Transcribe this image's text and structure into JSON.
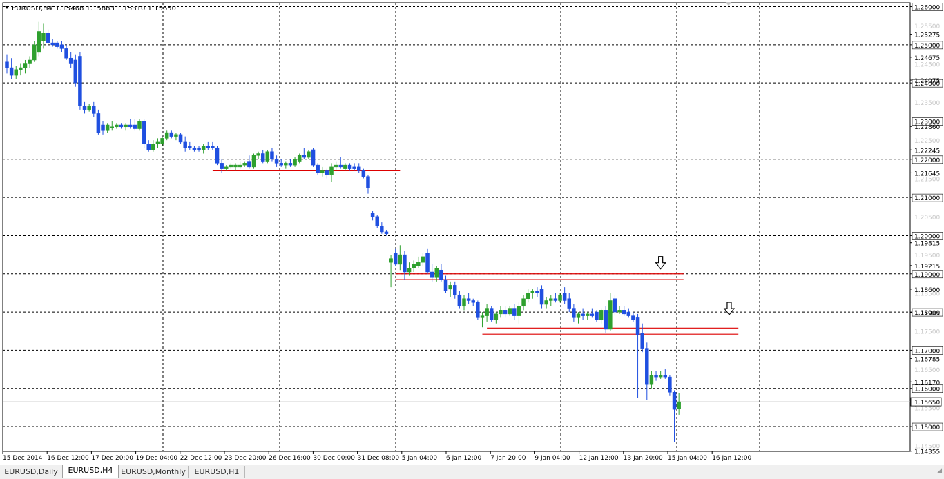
{
  "chart_header": {
    "symbol_label": "EURUSD,H4",
    "ohlc_text": "1.15468 1.15883 1.15310 1.15650"
  },
  "price_axis": {
    "main_labels": [
      "1.26000",
      "1.25000",
      "1.24000",
      "1.23000",
      "1.22000",
      "1.21000",
      "1.20000",
      "1.19000",
      "1.18000",
      "1.17000",
      "1.16000",
      "1.15000"
    ],
    "faint_labels": [
      "1.25500",
      "1.24500",
      "1.23500",
      "1.22500",
      "1.21500",
      "1.20500",
      "1.19500",
      "1.18500",
      "1.17500",
      "1.16500",
      "1.15500",
      "1.14500"
    ],
    "extra_labels": [
      "1.25275",
      "1.24675",
      "1.24075",
      "1.22860",
      "1.22245",
      "1.21645",
      "1.19815",
      "1.19215",
      "1.18600",
      "1.17985",
      "1.16785",
      "1.16170",
      "1.14355"
    ],
    "current_price": "1.15650"
  },
  "time_axis": {
    "labels": [
      "15 Dec 2014",
      "16 Dec 12:00",
      "17 Dec 20:00",
      "19 Dec 04:00",
      "22 Dec 12:00",
      "23 Dec 20:00",
      "26 Dec 16:00",
      "30 Dec 00:00",
      "31 Dec 08:00",
      "5 Jan 04:00",
      "6 Jan 12:00",
      "7 Jan 20:00",
      "9 Jan 04:00",
      "12 Jan 12:00",
      "13 Jan 20:00",
      "15 Jan 04:00",
      "16 Jan 12:00"
    ]
  },
  "tabs": [
    {
      "label": "EURUSD,Daily",
      "active": false
    },
    {
      "label": "EURUSD,H4",
      "active": true
    },
    {
      "label": "EURUSD,Monthly",
      "active": false
    },
    {
      "label": "EURUSD,H1",
      "active": false
    }
  ],
  "colors": {
    "bull": "#2ea02e",
    "bear": "#1f4fe0",
    "level_line": "#dd0000",
    "grid": "#000000"
  },
  "chart_data": {
    "type": "candlestick",
    "symbol": "EURUSD",
    "timeframe": "H4",
    "ylim": [
      1.1435,
      1.261
    ],
    "candles": [
      {
        "o": 1.2455,
        "h": 1.2475,
        "l": 1.2425,
        "c": 1.244
      },
      {
        "o": 1.244,
        "h": 1.2465,
        "l": 1.241,
        "c": 1.242
      },
      {
        "o": 1.242,
        "h": 1.2445,
        "l": 1.241,
        "c": 1.2435
      },
      {
        "o": 1.2435,
        "h": 1.245,
        "l": 1.242,
        "c": 1.244
      },
      {
        "o": 1.244,
        "h": 1.246,
        "l": 1.2425,
        "c": 1.245
      },
      {
        "o": 1.245,
        "h": 1.247,
        "l": 1.244,
        "c": 1.246
      },
      {
        "o": 1.246,
        "h": 1.251,
        "l": 1.2455,
        "c": 1.25
      },
      {
        "o": 1.248,
        "h": 1.256,
        "l": 1.247,
        "c": 1.2535
      },
      {
        "o": 1.251,
        "h": 1.2555,
        "l": 1.249,
        "c": 1.253
      },
      {
        "o": 1.253,
        "h": 1.254,
        "l": 1.25,
        "c": 1.2505
      },
      {
        "o": 1.2505,
        "h": 1.2515,
        "l": 1.2495,
        "c": 1.25
      },
      {
        "o": 1.2505,
        "h": 1.251,
        "l": 1.249,
        "c": 1.2495
      },
      {
        "o": 1.25,
        "h": 1.251,
        "l": 1.248,
        "c": 1.249
      },
      {
        "o": 1.249,
        "h": 1.25,
        "l": 1.246,
        "c": 1.2465
      },
      {
        "o": 1.2465,
        "h": 1.248,
        "l": 1.244,
        "c": 1.245
      },
      {
        "o": 1.246,
        "h": 1.2475,
        "l": 1.239,
        "c": 1.24
      },
      {
        "o": 1.247,
        "h": 1.248,
        "l": 1.233,
        "c": 1.234
      },
      {
        "o": 1.234,
        "h": 1.235,
        "l": 1.232,
        "c": 1.233
      },
      {
        "o": 1.233,
        "h": 1.2345,
        "l": 1.2325,
        "c": 1.234
      },
      {
        "o": 1.234,
        "h": 1.235,
        "l": 1.231,
        "c": 1.232
      },
      {
        "o": 1.232,
        "h": 1.233,
        "l": 1.2265,
        "c": 1.227
      },
      {
        "o": 1.229,
        "h": 1.23,
        "l": 1.2265,
        "c": 1.2275
      },
      {
        "o": 1.2275,
        "h": 1.2295,
        "l": 1.227,
        "c": 1.229
      },
      {
        "o": 1.2285,
        "h": 1.23,
        "l": 1.2275,
        "c": 1.2285
      },
      {
        "o": 1.2285,
        "h": 1.2295,
        "l": 1.228,
        "c": 1.229
      },
      {
        "o": 1.229,
        "h": 1.2295,
        "l": 1.228,
        "c": 1.2285
      },
      {
        "o": 1.2285,
        "h": 1.2295,
        "l": 1.2275,
        "c": 1.229
      },
      {
        "o": 1.229,
        "h": 1.2305,
        "l": 1.228,
        "c": 1.2285
      },
      {
        "o": 1.229,
        "h": 1.2305,
        "l": 1.2275,
        "c": 1.228
      },
      {
        "o": 1.228,
        "h": 1.2305,
        "l": 1.2275,
        "c": 1.23
      },
      {
        "o": 1.23,
        "h": 1.2305,
        "l": 1.223,
        "c": 1.224
      },
      {
        "o": 1.224,
        "h": 1.225,
        "l": 1.222,
        "c": 1.2225
      },
      {
        "o": 1.2225,
        "h": 1.225,
        "l": 1.222,
        "c": 1.224
      },
      {
        "o": 1.224,
        "h": 1.2255,
        "l": 1.223,
        "c": 1.2245
      },
      {
        "o": 1.224,
        "h": 1.226,
        "l": 1.2235,
        "c": 1.2255
      },
      {
        "o": 1.2255,
        "h": 1.2275,
        "l": 1.225,
        "c": 1.227
      },
      {
        "o": 1.227,
        "h": 1.2275,
        "l": 1.2255,
        "c": 1.226
      },
      {
        "o": 1.226,
        "h": 1.227,
        "l": 1.225,
        "c": 1.2265
      },
      {
        "o": 1.2265,
        "h": 1.227,
        "l": 1.224,
        "c": 1.2245
      },
      {
        "o": 1.2245,
        "h": 1.226,
        "l": 1.222,
        "c": 1.223
      },
      {
        "o": 1.2235,
        "h": 1.2245,
        "l": 1.2225,
        "c": 1.223
      },
      {
        "o": 1.223,
        "h": 1.2235,
        "l": 1.222,
        "c": 1.2225
      },
      {
        "o": 1.223,
        "h": 1.2235,
        "l": 1.222,
        "c": 1.2225
      },
      {
        "o": 1.2225,
        "h": 1.224,
        "l": 1.2215,
        "c": 1.2235
      },
      {
        "o": 1.2235,
        "h": 1.2245,
        "l": 1.2225,
        "c": 1.223
      },
      {
        "o": 1.2235,
        "h": 1.2245,
        "l": 1.2225,
        "c": 1.223
      },
      {
        "o": 1.223,
        "h": 1.2235,
        "l": 1.2185,
        "c": 1.219
      },
      {
        "o": 1.219,
        "h": 1.22,
        "l": 1.2165,
        "c": 1.2175
      },
      {
        "o": 1.2175,
        "h": 1.2185,
        "l": 1.217,
        "c": 1.218
      },
      {
        "o": 1.218,
        "h": 1.219,
        "l": 1.2175,
        "c": 1.2185
      },
      {
        "o": 1.218,
        "h": 1.219,
        "l": 1.217,
        "c": 1.2185
      },
      {
        "o": 1.218,
        "h": 1.2195,
        "l": 1.2175,
        "c": 1.2185
      },
      {
        "o": 1.2185,
        "h": 1.2195,
        "l": 1.218,
        "c": 1.219
      },
      {
        "o": 1.2195,
        "h": 1.221,
        "l": 1.2175,
        "c": 1.218
      },
      {
        "o": 1.218,
        "h": 1.2215,
        "l": 1.2175,
        "c": 1.221
      },
      {
        "o": 1.221,
        "h": 1.222,
        "l": 1.22,
        "c": 1.2215
      },
      {
        "o": 1.2215,
        "h": 1.2225,
        "l": 1.219,
        "c": 1.2195
      },
      {
        "o": 1.2195,
        "h": 1.2225,
        "l": 1.219,
        "c": 1.222
      },
      {
        "o": 1.222,
        "h": 1.223,
        "l": 1.2195,
        "c": 1.22
      },
      {
        "o": 1.22,
        "h": 1.221,
        "l": 1.218,
        "c": 1.219
      },
      {
        "o": 1.219,
        "h": 1.22,
        "l": 1.218,
        "c": 1.2185
      },
      {
        "o": 1.2185,
        "h": 1.2195,
        "l": 1.2175,
        "c": 1.219
      },
      {
        "o": 1.219,
        "h": 1.22,
        "l": 1.218,
        "c": 1.2185
      },
      {
        "o": 1.2185,
        "h": 1.2205,
        "l": 1.218,
        "c": 1.22
      },
      {
        "o": 1.2195,
        "h": 1.2215,
        "l": 1.219,
        "c": 1.221
      },
      {
        "o": 1.221,
        "h": 1.223,
        "l": 1.22,
        "c": 1.2205
      },
      {
        "o": 1.2205,
        "h": 1.2225,
        "l": 1.22,
        "c": 1.222
      },
      {
        "o": 1.2225,
        "h": 1.223,
        "l": 1.218,
        "c": 1.2185
      },
      {
        "o": 1.2185,
        "h": 1.219,
        "l": 1.216,
        "c": 1.2165
      },
      {
        "o": 1.2165,
        "h": 1.218,
        "l": 1.2155,
        "c": 1.217
      },
      {
        "o": 1.217,
        "h": 1.2175,
        "l": 1.215,
        "c": 1.216
      },
      {
        "o": 1.216,
        "h": 1.219,
        "l": 1.214,
        "c": 1.218
      },
      {
        "o": 1.218,
        "h": 1.2195,
        "l": 1.217,
        "c": 1.2185
      },
      {
        "o": 1.2185,
        "h": 1.2205,
        "l": 1.2175,
        "c": 1.218
      },
      {
        "o": 1.2175,
        "h": 1.219,
        "l": 1.217,
        "c": 1.2185
      },
      {
        "o": 1.2185,
        "h": 1.219,
        "l": 1.217,
        "c": 1.2175
      },
      {
        "o": 1.218,
        "h": 1.219,
        "l": 1.217,
        "c": 1.2175
      },
      {
        "o": 1.218,
        "h": 1.219,
        "l": 1.2165,
        "c": 1.217
      },
      {
        "o": 1.217,
        "h": 1.2175,
        "l": 1.215,
        "c": 1.2155
      },
      {
        "o": 1.2155,
        "h": 1.216,
        "l": 1.211,
        "c": 1.2125
      },
      {
        "o": 1.206,
        "h": 1.2065,
        "l": 1.204,
        "c": 1.205
      },
      {
        "o": 1.205,
        "h": 1.2055,
        "l": 1.202,
        "c": 1.2025
      },
      {
        "o": 1.2025,
        "h": 1.2035,
        "l": 1.2005,
        "c": 1.201
      },
      {
        "o": 1.201,
        "h": 1.2015,
        "l": 1.2,
        "c": 1.2005
      },
      {
        "o": 1.193,
        "h": 1.195,
        "l": 1.1865,
        "c": 1.194
      },
      {
        "o": 1.1955,
        "h": 1.1965,
        "l": 1.192,
        "c": 1.1925
      },
      {
        "o": 1.1925,
        "h": 1.1975,
        "l": 1.191,
        "c": 1.195
      },
      {
        "o": 1.195,
        "h": 1.196,
        "l": 1.1885,
        "c": 1.1905
      },
      {
        "o": 1.1905,
        "h": 1.193,
        "l": 1.1895,
        "c": 1.1915
      },
      {
        "o": 1.1915,
        "h": 1.1935,
        "l": 1.1905,
        "c": 1.1925
      },
      {
        "o": 1.192,
        "h": 1.1945,
        "l": 1.1915,
        "c": 1.193
      },
      {
        "o": 1.193,
        "h": 1.1955,
        "l": 1.192,
        "c": 1.1945
      },
      {
        "o": 1.1955,
        "h": 1.1965,
        "l": 1.19,
        "c": 1.1905
      },
      {
        "o": 1.1905,
        "h": 1.1925,
        "l": 1.188,
        "c": 1.189
      },
      {
        "o": 1.189,
        "h": 1.192,
        "l": 1.188,
        "c": 1.1915
      },
      {
        "o": 1.191,
        "h": 1.1925,
        "l": 1.188,
        "c": 1.1885
      },
      {
        "o": 1.1885,
        "h": 1.1895,
        "l": 1.185,
        "c": 1.1855
      },
      {
        "o": 1.186,
        "h": 1.188,
        "l": 1.184,
        "c": 1.187
      },
      {
        "o": 1.187,
        "h": 1.188,
        "l": 1.1835,
        "c": 1.1845
      },
      {
        "o": 1.1845,
        "h": 1.1855,
        "l": 1.181,
        "c": 1.1815
      },
      {
        "o": 1.1815,
        "h": 1.1845,
        "l": 1.1805,
        "c": 1.1835
      },
      {
        "o": 1.1835,
        "h": 1.185,
        "l": 1.182,
        "c": 1.183
      },
      {
        "o": 1.183,
        "h": 1.1835,
        "l": 1.1815,
        "c": 1.1825
      },
      {
        "o": 1.1825,
        "h": 1.183,
        "l": 1.178,
        "c": 1.1785
      },
      {
        "o": 1.1785,
        "h": 1.18,
        "l": 1.176,
        "c": 1.179
      },
      {
        "o": 1.179,
        "h": 1.182,
        "l": 1.1775,
        "c": 1.181
      },
      {
        "o": 1.181,
        "h": 1.1815,
        "l": 1.1775,
        "c": 1.178
      },
      {
        "o": 1.178,
        "h": 1.18,
        "l": 1.177,
        "c": 1.1795
      },
      {
        "o": 1.1795,
        "h": 1.1815,
        "l": 1.1785,
        "c": 1.1805
      },
      {
        "o": 1.1805,
        "h": 1.1815,
        "l": 1.1785,
        "c": 1.1795
      },
      {
        "o": 1.1795,
        "h": 1.1815,
        "l": 1.179,
        "c": 1.181
      },
      {
        "o": 1.181,
        "h": 1.182,
        "l": 1.178,
        "c": 1.179
      },
      {
        "o": 1.179,
        "h": 1.1825,
        "l": 1.177,
        "c": 1.1815
      },
      {
        "o": 1.1815,
        "h": 1.1845,
        "l": 1.1805,
        "c": 1.1835
      },
      {
        "o": 1.1835,
        "h": 1.186,
        "l": 1.1825,
        "c": 1.185
      },
      {
        "o": 1.185,
        "h": 1.186,
        "l": 1.1835,
        "c": 1.1855
      },
      {
        "o": 1.1855,
        "h": 1.1865,
        "l": 1.184,
        "c": 1.185
      },
      {
        "o": 1.186,
        "h": 1.187,
        "l": 1.181,
        "c": 1.182
      },
      {
        "o": 1.182,
        "h": 1.184,
        "l": 1.181,
        "c": 1.183
      },
      {
        "o": 1.183,
        "h": 1.1845,
        "l": 1.1815,
        "c": 1.1835
      },
      {
        "o": 1.1835,
        "h": 1.185,
        "l": 1.1825,
        "c": 1.183
      },
      {
        "o": 1.183,
        "h": 1.185,
        "l": 1.1825,
        "c": 1.1845
      },
      {
        "o": 1.185,
        "h": 1.1865,
        "l": 1.182,
        "c": 1.183
      },
      {
        "o": 1.1835,
        "h": 1.185,
        "l": 1.18,
        "c": 1.181
      },
      {
        "o": 1.181,
        "h": 1.182,
        "l": 1.1775,
        "c": 1.1785
      },
      {
        "o": 1.1785,
        "h": 1.18,
        "l": 1.177,
        "c": 1.1795
      },
      {
        "o": 1.1795,
        "h": 1.181,
        "l": 1.178,
        "c": 1.179
      },
      {
        "o": 1.179,
        "h": 1.18,
        "l": 1.178,
        "c": 1.1795
      },
      {
        "o": 1.1795,
        "h": 1.181,
        "l": 1.1785,
        "c": 1.179
      },
      {
        "o": 1.18,
        "h": 1.1805,
        "l": 1.1775,
        "c": 1.178
      },
      {
        "o": 1.178,
        "h": 1.181,
        "l": 1.177,
        "c": 1.1805
      },
      {
        "o": 1.1805,
        "h": 1.1815,
        "l": 1.1745,
        "c": 1.1755
      },
      {
        "o": 1.1755,
        "h": 1.185,
        "l": 1.175,
        "c": 1.183
      },
      {
        "o": 1.1835,
        "h": 1.1845,
        "l": 1.179,
        "c": 1.18
      },
      {
        "o": 1.18,
        "h": 1.1815,
        "l": 1.1795,
        "c": 1.1805
      },
      {
        "o": 1.1805,
        "h": 1.1815,
        "l": 1.179,
        "c": 1.1795
      },
      {
        "o": 1.18,
        "h": 1.181,
        "l": 1.1785,
        "c": 1.179
      },
      {
        "o": 1.179,
        "h": 1.18,
        "l": 1.1775,
        "c": 1.178
      },
      {
        "o": 1.1785,
        "h": 1.1795,
        "l": 1.1575,
        "c": 1.174
      },
      {
        "o": 1.1745,
        "h": 1.177,
        "l": 1.1695,
        "c": 1.1705
      },
      {
        "o": 1.1705,
        "h": 1.172,
        "l": 1.157,
        "c": 1.161
      },
      {
        "o": 1.161,
        "h": 1.1645,
        "l": 1.16,
        "c": 1.1635
      },
      {
        "o": 1.1635,
        "h": 1.1645,
        "l": 1.162,
        "c": 1.163
      },
      {
        "o": 1.163,
        "h": 1.1645,
        "l": 1.1625,
        "c": 1.1635
      },
      {
        "o": 1.1635,
        "h": 1.165,
        "l": 1.1625,
        "c": 1.163
      },
      {
        "o": 1.163,
        "h": 1.1635,
        "l": 1.158,
        "c": 1.159
      },
      {
        "o": 1.159,
        "h": 1.1595,
        "l": 1.146,
        "c": 1.1545
      },
      {
        "o": 1.1547,
        "h": 1.1588,
        "l": 1.1531,
        "c": 1.1565
      }
    ],
    "horizontal_lines": [
      {
        "price": 1.217,
        "x_start_index": 45,
        "x_end_index": 86
      },
      {
        "price": 1.19,
        "x_start_index": 85,
        "x_end_index": 148
      },
      {
        "price": 1.1885,
        "x_start_index": 85,
        "x_end_index": 148
      },
      {
        "price": 1.1758,
        "x_start_index": 105,
        "x_end_index": 160
      },
      {
        "price": 1.1742,
        "x_start_index": 104,
        "x_end_index": 160
      }
    ],
    "arrows": [
      {
        "at_index": 143,
        "price": 1.192
      },
      {
        "at_index": 158,
        "price": 1.18
      }
    ],
    "grid": true
  }
}
